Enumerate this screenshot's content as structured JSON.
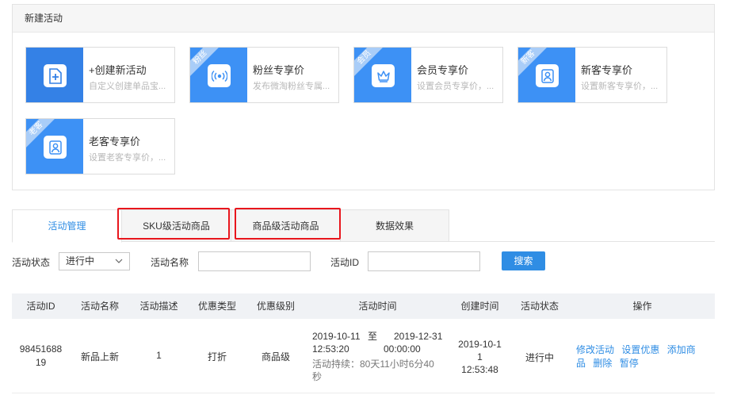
{
  "new_activity": {
    "header": "新建活动",
    "cards": [
      {
        "icon": "plus-document-icon",
        "ribbon": "",
        "title": "+创建新活动",
        "desc": "自定义创建单品宝..."
      },
      {
        "icon": "broadcast-icon",
        "ribbon": "粉丝",
        "title": "粉丝专享价",
        "desc": "发布微淘粉丝专属..."
      },
      {
        "icon": "crown-icon",
        "ribbon": "会员",
        "title": "会员专享价",
        "desc": "设置会员专享价，..."
      },
      {
        "icon": "user-icon",
        "ribbon": "新客",
        "title": "新客专享价",
        "desc": "设置新客专享价，..."
      },
      {
        "icon": "user-icon",
        "ribbon": "老客",
        "title": "老客专享价",
        "desc": "设置老客专享价，..."
      }
    ]
  },
  "tabs": [
    {
      "label": "活动管理",
      "active": true
    },
    {
      "label": "SKU级活动商品",
      "active": false
    },
    {
      "label": "商品级活动商品",
      "active": false
    },
    {
      "label": "数据效果",
      "active": false
    }
  ],
  "filters": {
    "status_label": "活动状态",
    "status_value": "进行中",
    "name_label": "活动名称",
    "name_value": "",
    "id_label": "活动ID",
    "id_value": "",
    "search_button": "搜索"
  },
  "table": {
    "columns": [
      "活动ID",
      "活动名称",
      "活动描述",
      "优惠类型",
      "优惠级别",
      "活动时间",
      "创建时间",
      "活动状态",
      "操作"
    ],
    "rows": [
      {
        "id_line1": "98451688",
        "id_line2": "19",
        "name": "新品上新",
        "desc": "1",
        "discount_type": "打折",
        "discount_level": "商品级",
        "start_date": "2019-10-11",
        "start_time": "12:53:20",
        "to": "至",
        "end_date": "2019-12-31",
        "end_time": "00:00:00",
        "duration_line1": "活动持续：80天11小时6分40",
        "duration_line2": "秒",
        "created_line1": "2019-10-1",
        "created_line2": "1",
        "created_line3": "12:53:48",
        "status": "进行中",
        "ops": {
          "edit": "修改活动",
          "set_discount": "设置优惠",
          "add_goods_a": "添加商",
          "add_goods_b": "品",
          "delete": "删除",
          "pause": "暂停"
        }
      }
    ]
  },
  "colors": {
    "accent": "#2f8de4",
    "highlight_box": "#e8161d",
    "icon_bg": "#3d91f5"
  }
}
